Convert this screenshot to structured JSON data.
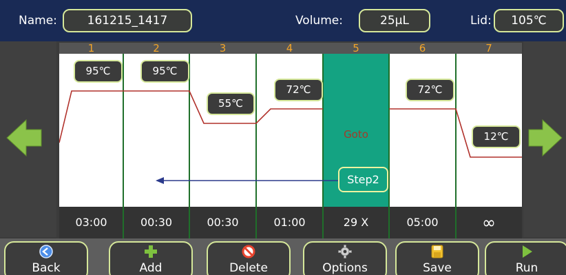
{
  "header": {
    "name_label": "Name:",
    "name_value": "161215_1417",
    "volume_label": "Volume:",
    "volume_value": "25µL",
    "lid_label": "Lid:",
    "lid_value": "105℃"
  },
  "steps": [
    {
      "number": "1",
      "temp": "95℃",
      "time": "03:00"
    },
    {
      "number": "2",
      "temp": "95℃",
      "time": "00:30"
    },
    {
      "number": "3",
      "temp": "55℃",
      "time": "00:30"
    },
    {
      "number": "4",
      "temp": "72℃",
      "time": "01:00"
    },
    {
      "number": "5",
      "goto_label": "Goto",
      "goto_target": "Step2",
      "time": "29 X"
    },
    {
      "number": "6",
      "temp": "72℃",
      "time": "05:00"
    },
    {
      "number": "7",
      "temp": "12℃",
      "time": "∞"
    }
  ],
  "toolbar": {
    "back": "Back",
    "add": "Add",
    "delete": "Delete",
    "options": "Options",
    "save": "Save",
    "run": "Run"
  },
  "icons": {
    "left_arrow": "arrow-left-icon",
    "right_arrow": "arrow-right-icon",
    "back": "back-icon",
    "add": "plus-icon",
    "delete": "no-entry-icon",
    "options": "gear-icon",
    "save": "floppy-icon",
    "run": "play-icon"
  },
  "colors": {
    "header_bg": "#192a55",
    "accent_border": "#d6e89a",
    "goto_column": "#14a382",
    "step_number": "#f3a52a",
    "profile_line": "#b0302a",
    "goto_arrow": "#2b3a8c",
    "arrow_green": "#8bc34a"
  }
}
